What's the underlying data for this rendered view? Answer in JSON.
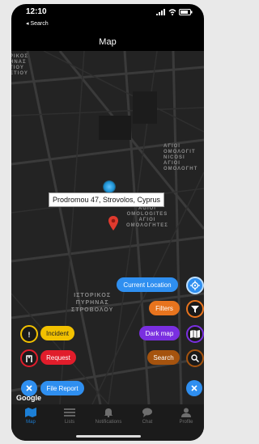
{
  "status_bar": {
    "time": "12:10",
    "back_label": "◂ Search"
  },
  "header": {
    "title": "Map"
  },
  "map": {
    "labels": {
      "top_left": "ΡΙΚΟΣ\nΗΝΑΣ\nΤΙΟΥ\nΕΤΙΟΥ",
      "right_block": "ΑΓΙΟΙ\nΟΜΟΛΟΓΙΤ\nNICOSI\nΑΓΙΟΙ\nΟΜΟΛΟΓΗΤ",
      "center_block": "AGIOI\nOMOLOGITES\nΑΓΙΟΙ\nΟΜΟΛΟΓΗΤΕΣ",
      "bottom_block": "ΙΣΤΟΡΙΚΟΣ\nΠΥΡΗΝΑΣ\nΣΤΡΟΒΟΛΟΥ"
    },
    "callout": "Prodromou 47, Strovolos, Cyprus",
    "google_logo": "Google"
  },
  "buttons": {
    "current_location": "Current Location",
    "filters": "Filters",
    "dark_map": "Dark map",
    "search": "Search",
    "incident": "Incident",
    "request": "Request",
    "file_report": "File Report"
  },
  "tabs": [
    {
      "label": "Map"
    },
    {
      "label": "Lists"
    },
    {
      "label": "Notifications"
    },
    {
      "label": "Chat"
    },
    {
      "label": "Profile"
    }
  ],
  "colors": {
    "blue": "#2f8ff0",
    "orange": "#e8741e",
    "purple": "#7a2fe0",
    "brown": "#a5530e",
    "yellow": "#f2c100",
    "red": "#e11d2b",
    "tab_active": "#1c7fd6"
  }
}
